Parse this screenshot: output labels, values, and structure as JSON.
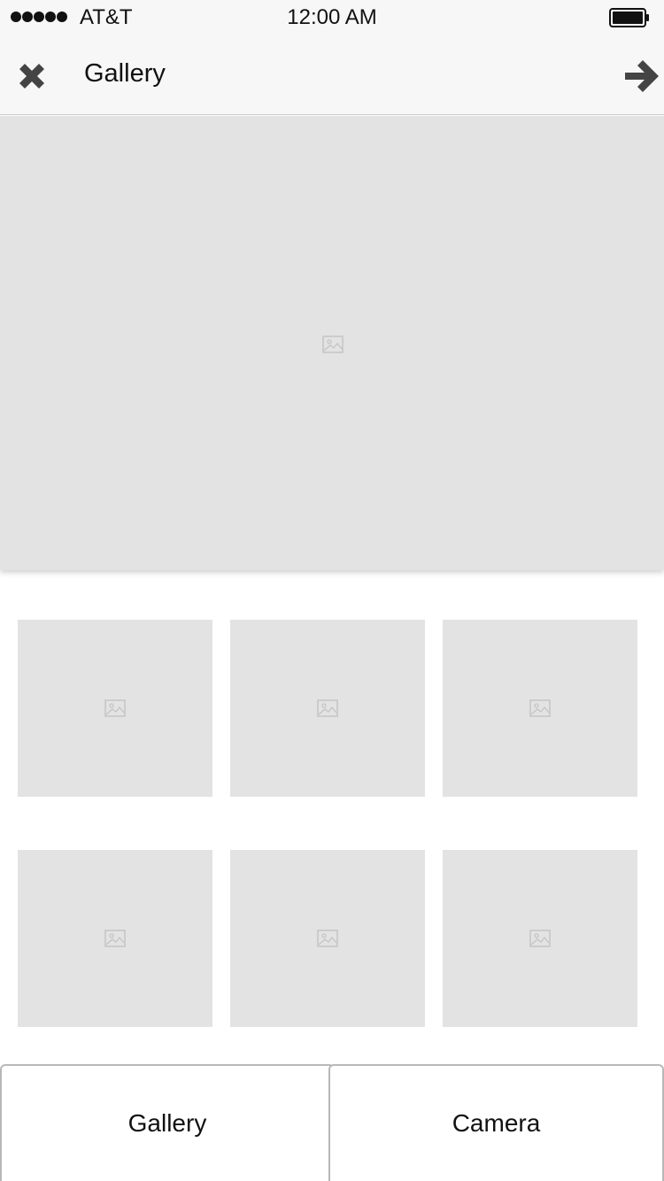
{
  "status_bar": {
    "carrier": "AT&T",
    "time": "12:00 AM",
    "signal_dots": 5,
    "icons": {
      "signal": "signal-dots-icon",
      "battery": "battery-full-icon"
    }
  },
  "nav": {
    "title": "Gallery",
    "close_icon": "close-x-icon",
    "next_icon": "arrow-right-icon"
  },
  "preview": {
    "icon": "image-placeholder-icon"
  },
  "thumbnails": [
    {
      "icon": "image-placeholder-icon"
    },
    {
      "icon": "image-placeholder-icon"
    },
    {
      "icon": "image-placeholder-icon"
    },
    {
      "icon": "image-placeholder-icon"
    },
    {
      "icon": "image-placeholder-icon"
    },
    {
      "icon": "image-placeholder-icon"
    }
  ],
  "bottom_buttons": {
    "gallery_label": "Gallery",
    "camera_label": "Camera"
  },
  "colors": {
    "bar_background": "#f7f7f7",
    "placeholder": "#e3e3e3",
    "icon_dark": "#444444",
    "button_border": "#b8b8b8"
  }
}
